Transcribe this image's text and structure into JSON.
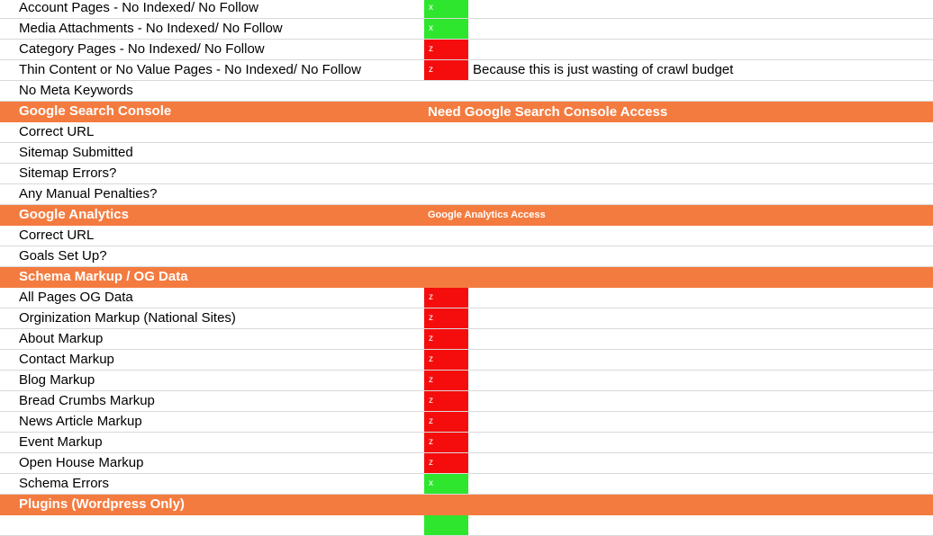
{
  "colors": {
    "header_bg": "#f47b3f",
    "status_green": "#2ee62e",
    "status_red": "#f50d0d"
  },
  "rows": [
    {
      "kind": "item",
      "label": "Account Pages - No Indexed/ No Follow",
      "status": "x",
      "status_color": "green",
      "note": ""
    },
    {
      "kind": "item",
      "label": "Media Attachments - No Indexed/ No Follow",
      "status": "x",
      "status_color": "green",
      "note": ""
    },
    {
      "kind": "item",
      "label": "Category Pages  - No Indexed/ No Follow",
      "status": "z",
      "status_color": "red",
      "note": ""
    },
    {
      "kind": "item",
      "label": "Thin Content or No Value Pages - No Indexed/ No Follow",
      "status": "z",
      "status_color": "red",
      "note": "Because this is just wasting of crawl budget"
    },
    {
      "kind": "item",
      "label": "No Meta Keywords",
      "status": "",
      "status_color": "",
      "note": ""
    },
    {
      "kind": "header",
      "label": "Google Search Console",
      "note": "Need Google Search Console Access",
      "note_size": "big"
    },
    {
      "kind": "item",
      "label": "Correct URL",
      "status": "",
      "status_color": "",
      "note": ""
    },
    {
      "kind": "item",
      "label": "Sitemap Submitted",
      "status": "",
      "status_color": "",
      "note": ""
    },
    {
      "kind": "item",
      "label": "Sitemap Errors?",
      "status": "",
      "status_color": "",
      "note": ""
    },
    {
      "kind": "item",
      "label": "Any Manual Penalties?",
      "status": "",
      "status_color": "",
      "note": ""
    },
    {
      "kind": "header",
      "label": "Google Analytics",
      "note": "Google Analytics Access",
      "note_size": "small"
    },
    {
      "kind": "item",
      "label": "Correct URL",
      "status": "",
      "status_color": "",
      "note": ""
    },
    {
      "kind": "item",
      "label": "Goals Set Up?",
      "status": "",
      "status_color": "",
      "note": ""
    },
    {
      "kind": "header",
      "label": "Schema Markup / OG Data",
      "note": "",
      "note_size": "big"
    },
    {
      "kind": "item",
      "label": "All Pages OG Data",
      "status": "z",
      "status_color": "red",
      "note": ""
    },
    {
      "kind": "item",
      "label": "Orginization Markup (National Sites)",
      "status": "z",
      "status_color": "red",
      "note": ""
    },
    {
      "kind": "item",
      "label": "About Markup",
      "status": "z",
      "status_color": "red",
      "note": ""
    },
    {
      "kind": "item",
      "label": "Contact Markup",
      "status": "z",
      "status_color": "red",
      "note": ""
    },
    {
      "kind": "item",
      "label": "Blog Markup",
      "status": "z",
      "status_color": "red",
      "note": ""
    },
    {
      "kind": "item",
      "label": "Bread Crumbs Markup",
      "status": "z",
      "status_color": "red",
      "note": ""
    },
    {
      "kind": "item",
      "label": "News Article Markup",
      "status": "z",
      "status_color": "red",
      "note": ""
    },
    {
      "kind": "item",
      "label": "Event Markup",
      "status": "z",
      "status_color": "red",
      "note": ""
    },
    {
      "kind": "item",
      "label": "Open House Markup",
      "status": "z",
      "status_color": "red",
      "note": ""
    },
    {
      "kind": "item",
      "label": "Schema Errors",
      "status": "x",
      "status_color": "green",
      "note": ""
    },
    {
      "kind": "header",
      "label": "Plugins (Wordpress Only)",
      "note": "",
      "note_size": "big"
    },
    {
      "kind": "item",
      "label": "",
      "status": "",
      "status_color": "green",
      "note": ""
    }
  ]
}
